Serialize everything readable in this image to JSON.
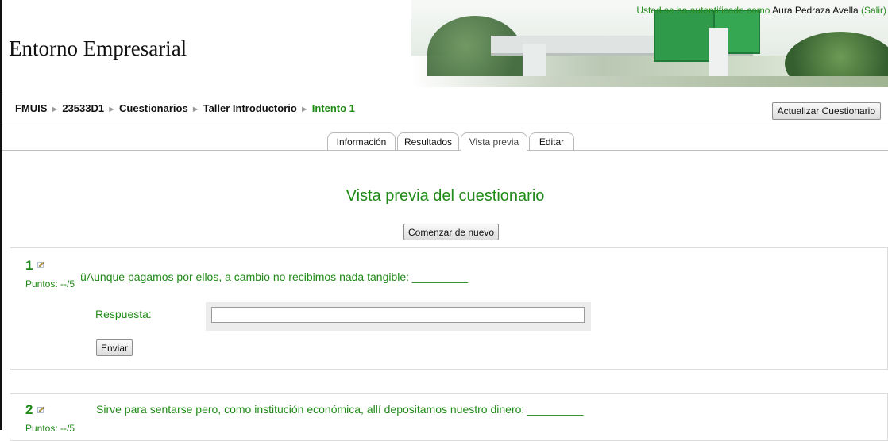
{
  "header": {
    "site_title": "Entorno Empresarial",
    "login_prefix": "Usted se ha autentificado como",
    "user_name": "Aura Pedraza Avella",
    "logout": "(Salir)"
  },
  "breadcrumb": {
    "items": [
      "FMUIS",
      "23533D1",
      "Cuestionarios",
      "Taller Introductorio"
    ],
    "current": "Intento 1",
    "separator": "►"
  },
  "update_button": "Actualizar Cuestionario",
  "tabs": [
    {
      "label": "Información",
      "selected": false
    },
    {
      "label": "Resultados",
      "selected": false
    },
    {
      "label": "Vista previa",
      "selected": true
    },
    {
      "label": "Editar",
      "selected": false
    }
  ],
  "preview_title": "Vista previa del cuestionario",
  "restart_button": "Comenzar de nuevo",
  "questions": [
    {
      "number": "1",
      "points": "Puntos: --/5",
      "text": "üAunque pagamos por ellos, a cambio no recibimos nada tangible: _________",
      "answer_label": "Respuesta:",
      "answer_value": "",
      "submit_label": "Enviar"
    },
    {
      "number": "2",
      "points": "Puntos: --/5",
      "text": "Sirve para sentarse pero, como institución económica, allí depositamos nuestro dinero: _________"
    }
  ],
  "colors": {
    "accent_green": "#1f8a16",
    "link_green": "#2a8a20",
    "border_gray": "#d8d8d8"
  },
  "icons": {
    "edit": "edit-icon"
  }
}
